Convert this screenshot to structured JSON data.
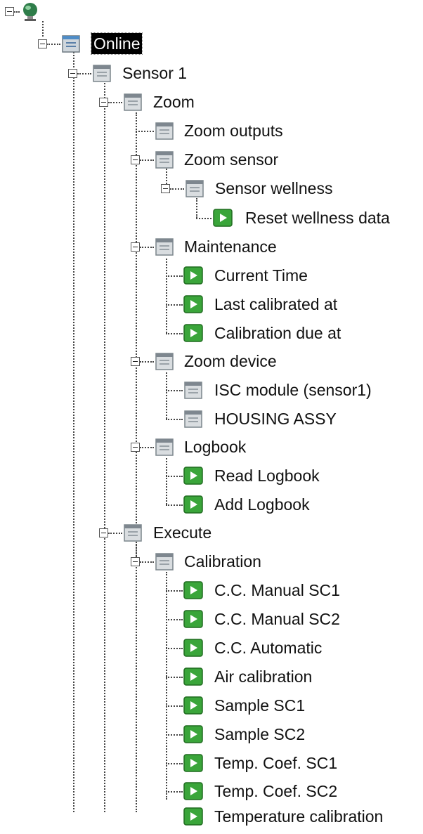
{
  "tree": {
    "root": {
      "icon": "device-globe-icon"
    },
    "online": {
      "label": "Online",
      "icon": "folder-menu-icon"
    },
    "sensor1": {
      "label": "Sensor 1",
      "icon": "folder-menu-icon"
    },
    "zoom": {
      "label": "Zoom",
      "icon": "folder-menu-icon"
    },
    "zoom_outputs": {
      "label": "Zoom outputs",
      "icon": "folder-menu-icon"
    },
    "zoom_sensor": {
      "label": "Zoom sensor",
      "icon": "folder-menu-icon"
    },
    "sensor_wellness": {
      "label": "Sensor wellness",
      "icon": "folder-menu-icon"
    },
    "reset_wellness": {
      "label": "Reset wellness data",
      "icon": "play-method-icon"
    },
    "maintenance": {
      "label": "Maintenance",
      "icon": "folder-menu-icon"
    },
    "current_time": {
      "label": "Current Time",
      "icon": "play-method-icon"
    },
    "last_calibrated": {
      "label": "Last calibrated at",
      "icon": "play-method-icon"
    },
    "calibration_due": {
      "label": "Calibration due at",
      "icon": "play-method-icon"
    },
    "zoom_device": {
      "label": "Zoom device",
      "icon": "folder-menu-icon"
    },
    "isc_module": {
      "label": "ISC module (sensor1)",
      "icon": "folder-menu-icon"
    },
    "housing_assy": {
      "label": "HOUSING ASSY",
      "icon": "folder-menu-icon"
    },
    "logbook": {
      "label": "Logbook",
      "icon": "folder-menu-icon"
    },
    "read_logbook": {
      "label": "Read Logbook",
      "icon": "play-method-icon"
    },
    "add_logbook": {
      "label": "Add Logbook",
      "icon": "play-method-icon"
    },
    "execute": {
      "label": "Execute",
      "icon": "folder-menu-icon"
    },
    "calibration": {
      "label": "Calibration",
      "icon": "folder-menu-icon"
    },
    "cc_manual_sc1": {
      "label": "C.C. Manual SC1",
      "icon": "play-method-icon"
    },
    "cc_manual_sc2": {
      "label": "C.C. Manual SC2",
      "icon": "play-method-icon"
    },
    "cc_automatic": {
      "label": "C.C. Automatic",
      "icon": "play-method-icon"
    },
    "air_calibration": {
      "label": "Air calibration",
      "icon": "play-method-icon"
    },
    "sample_sc1": {
      "label": "Sample SC1",
      "icon": "play-method-icon"
    },
    "sample_sc2": {
      "label": "Sample SC2",
      "icon": "play-method-icon"
    },
    "temp_coef_sc1": {
      "label": "Temp. Coef. SC1",
      "icon": "play-method-icon"
    },
    "temp_coef_sc2": {
      "label": "Temp. Coef. SC2",
      "icon": "play-method-icon"
    },
    "temp_calibration": {
      "label": "Temperature calibration",
      "icon": "play-method-icon"
    }
  },
  "colors": {
    "selection_bg": "#000000",
    "method_green": "#3aa53a",
    "folder_gray": "#9aa2a8"
  }
}
